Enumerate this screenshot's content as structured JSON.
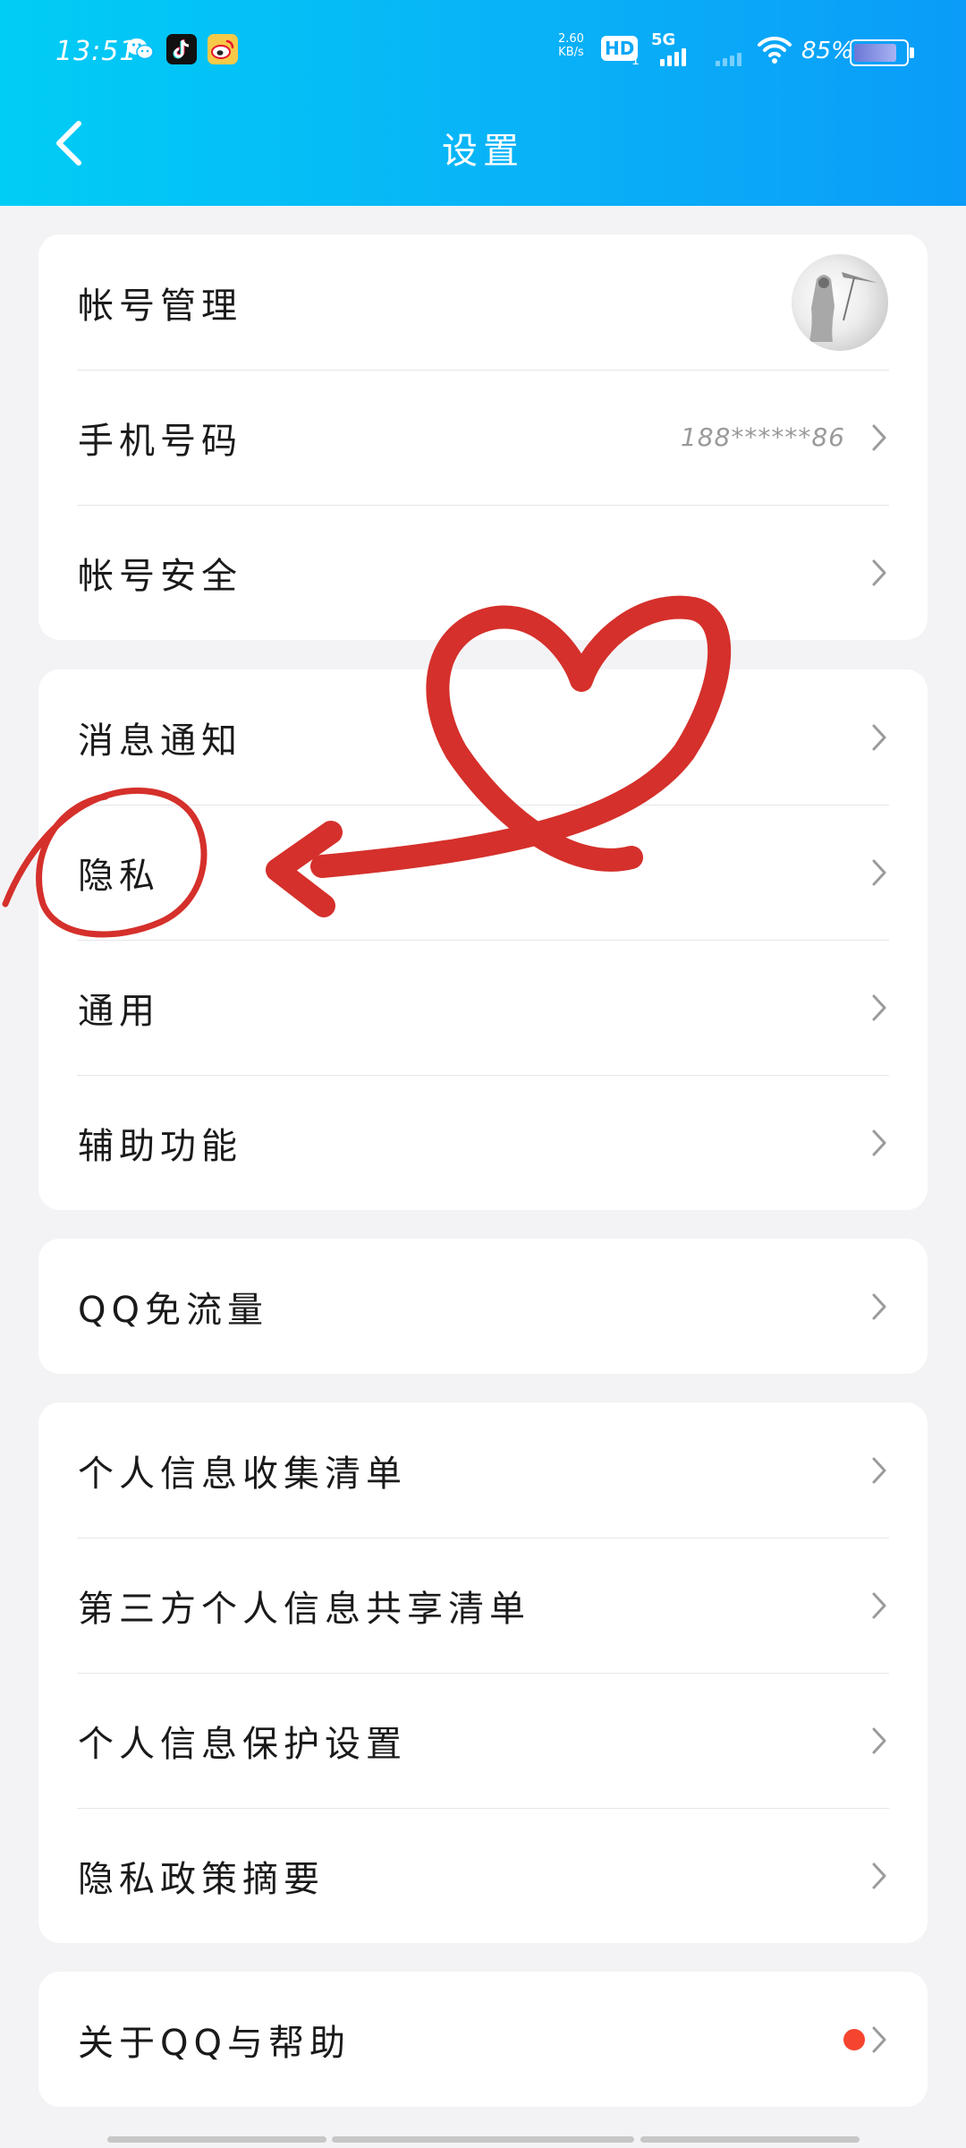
{
  "status_bar": {
    "time": "13:51",
    "net_speed_value": "2.60",
    "net_speed_unit": "KB/s",
    "hd_label": "HD",
    "sim_slot": "1",
    "network_type": "5G",
    "battery_percent": "85%",
    "battery_level": 0.85,
    "app_icons": [
      "wechat-icon",
      "tiktok-icon",
      "weibo-icon"
    ]
  },
  "header": {
    "title": "设置",
    "back_icon": "chevron-left-icon",
    "gradient_colors": [
      "#00cdf5",
      "#0a9cf8"
    ]
  },
  "groups": [
    {
      "items": [
        {
          "label": "帐号管理",
          "trailing": "avatar"
        },
        {
          "label": "手机号码",
          "value": "188******86",
          "trailing": "chevron"
        },
        {
          "label": "帐号安全",
          "trailing": "chevron"
        }
      ]
    },
    {
      "items": [
        {
          "label": "消息通知",
          "trailing": "chevron"
        },
        {
          "label": "隐私",
          "trailing": "chevron"
        },
        {
          "label": "通用",
          "trailing": "chevron"
        },
        {
          "label": "辅助功能",
          "trailing": "chevron"
        }
      ]
    },
    {
      "items": [
        {
          "label": "QQ免流量",
          "trailing": "chevron"
        }
      ]
    },
    {
      "items": [
        {
          "label": "个人信息收集清单",
          "trailing": "chevron"
        },
        {
          "label": "第三方个人信息共享清单",
          "trailing": "chevron"
        },
        {
          "label": "个人信息保护设置",
          "trailing": "chevron"
        },
        {
          "label": "隐私政策摘要",
          "trailing": "chevron"
        }
      ]
    },
    {
      "items": [
        {
          "label": "关于QQ与帮助",
          "trailing": "red-dot-chevron"
        }
      ]
    }
  ],
  "annotation": {
    "color": "#d9302c",
    "shapes": [
      "circle-around-privacy",
      "heart-arrow-pointing-to-privacy"
    ]
  },
  "colors": {
    "background": "#f3f3f5",
    "card": "#ffffff",
    "notification_dot": "#f5452f"
  }
}
